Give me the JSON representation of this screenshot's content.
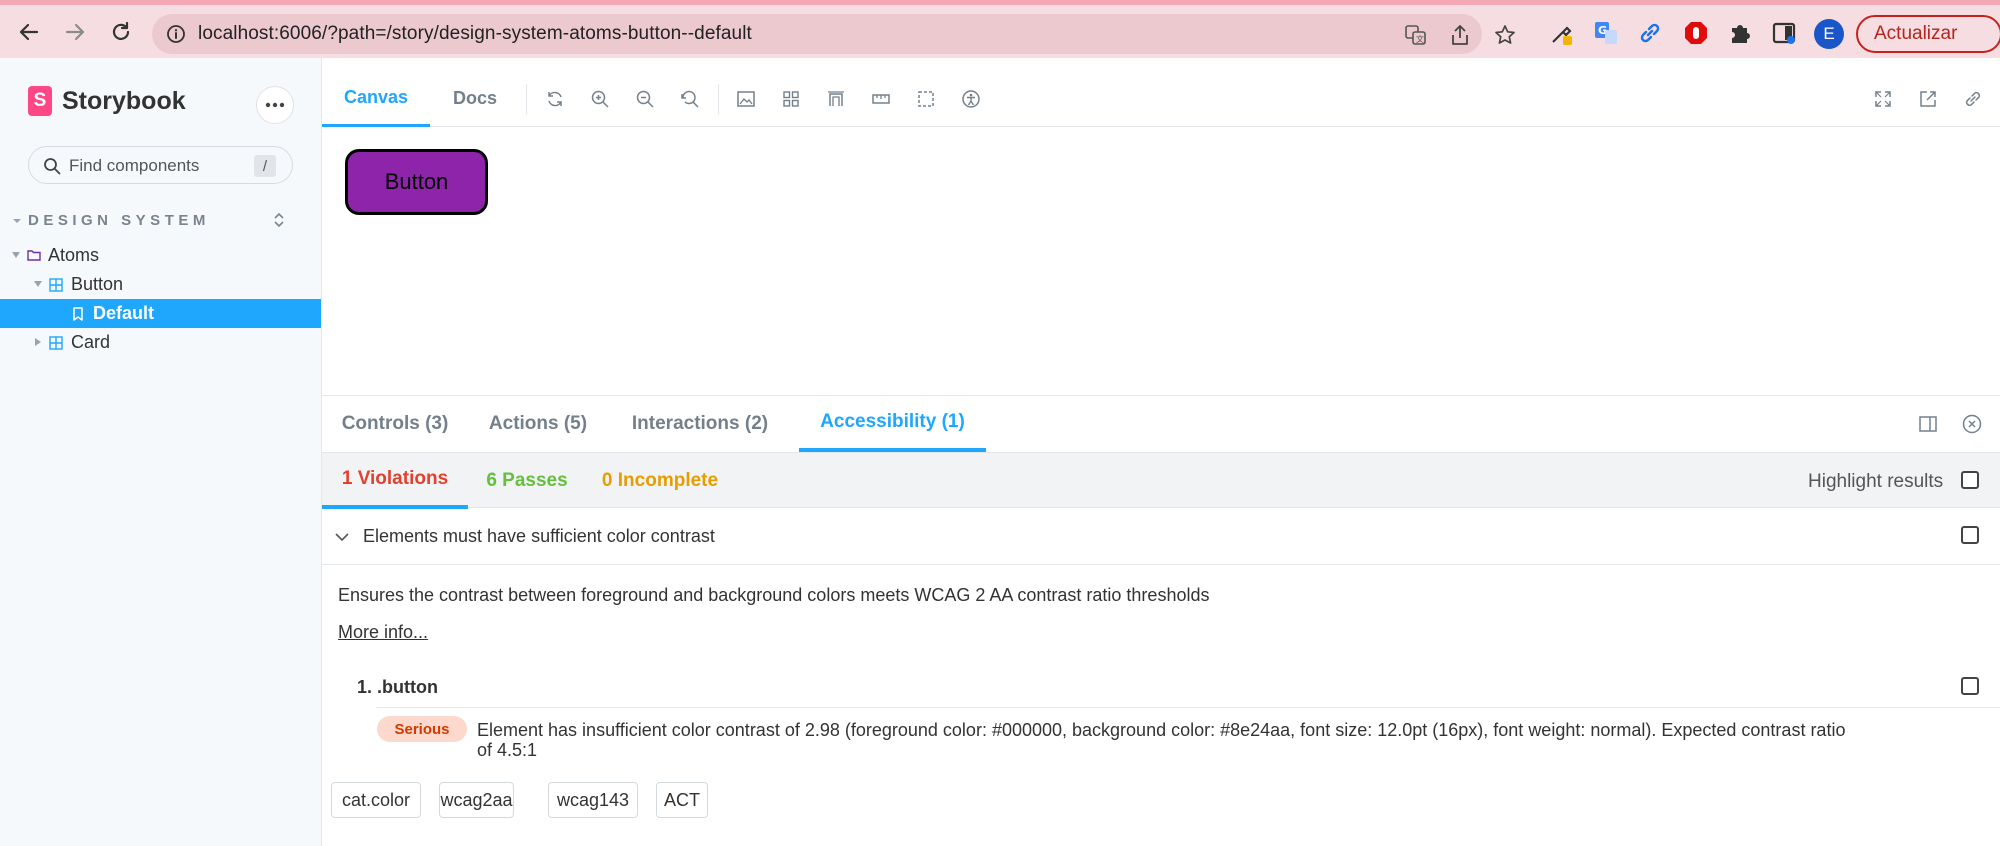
{
  "browser": {
    "url": "localhost:6006/?path=/story/design-system-atoms-button--default",
    "avatar_initial": "E",
    "update_label": "Actualizar"
  },
  "sidebar": {
    "brand": "Storybook",
    "search_placeholder": "Find components",
    "search_shortcut": "/",
    "group_title": "DESIGN SYSTEM",
    "tree": [
      {
        "label": "Atoms",
        "icon": "folder-icon",
        "expanded": true
      },
      {
        "label": "Button",
        "icon": "component-icon",
        "expanded": true
      },
      {
        "label": "Default",
        "icon": "bookmark-icon",
        "selected": true
      },
      {
        "label": "Card",
        "icon": "component-icon",
        "expanded": false
      }
    ]
  },
  "toolbar": {
    "tabs": [
      "Canvas",
      "Docs"
    ],
    "active_tab": "Canvas"
  },
  "canvas": {
    "button_label": "Button",
    "button_bg": "#8e24aa"
  },
  "addons": {
    "tabs": [
      "Controls (3)",
      "Actions (5)",
      "Interactions (2)",
      "Accessibility (1)"
    ],
    "active_tab": "Accessibility (1)",
    "subtabs": [
      {
        "label": "1 Violations",
        "color": "#e2412e"
      },
      {
        "label": "6 Passes",
        "color": "#66bf3c"
      },
      {
        "label": "0 Incomplete",
        "color": "#f0a000"
      }
    ],
    "highlight_label": "Highlight results",
    "rule": {
      "title": "Elements must have sufficient color contrast",
      "description": "Ensures the contrast between foreground and background colors meets WCAG 2 AA contrast ratio thresholds",
      "more_info": "More info...",
      "node_label": "1. .button",
      "impact": "Serious",
      "message_line1": "Element has insufficient color contrast of 2.98 (foreground color: #000000, background color: #8e24aa, font size: 12.0pt (16px), font weight: normal). Expected contrast ratio",
      "message_line2": "of 4.5:1",
      "tags": [
        "cat.color",
        "wcag2aa",
        "wcag143",
        "ACT"
      ]
    }
  }
}
